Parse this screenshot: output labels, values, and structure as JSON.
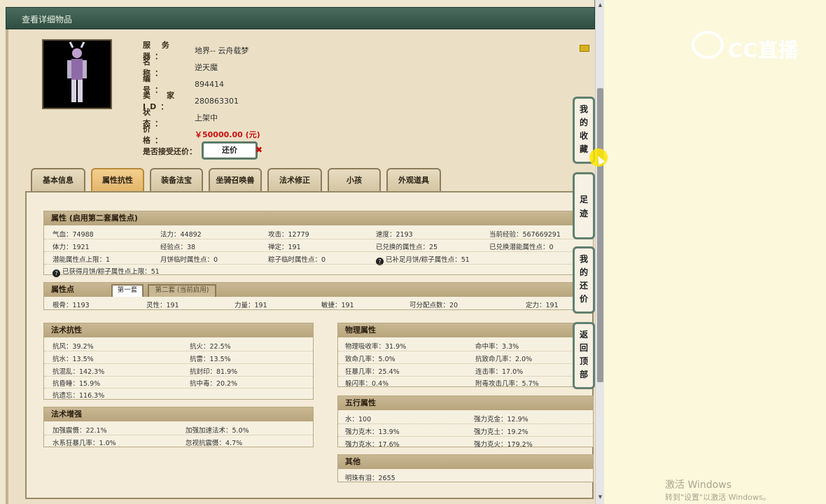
{
  "window": {
    "title": "查看详细物品"
  },
  "item": {
    "labels": {
      "server": "服 务 器：",
      "name": "名　　称：",
      "number": "编　　号：",
      "seller": "卖　家　ID：",
      "status": "状　　态：",
      "price": "价　　格：",
      "counter": "是否接受还价："
    },
    "server": "地界-- 云舟载梦",
    "name": "逆天魔",
    "number": "894414",
    "seller_id": "280863301",
    "status": "上架中",
    "price": "￥50000.00 (元)",
    "counter_button": "还价"
  },
  "tabs": [
    "基本信息",
    "属性抗性",
    "装备法宝",
    "坐骑召唤兽",
    "法术修正",
    "小孩",
    "外观道具"
  ],
  "active_tab": 1,
  "attributes": {
    "header": "属性 (启用第二套属性点)",
    "row1": [
      "气血：74988",
      "法力：44892",
      "攻击：12779",
      "速度：2193",
      "当前经验：567669291"
    ],
    "row2": [
      "体力：1921",
      "经验点：38",
      "禅定：191",
      "已兑换的属性点：25",
      "已兑换潜能属性点：0"
    ],
    "row3": [
      "潜能属性点上限：1",
      "月饼临时属性点：0",
      "粽子临时属性点：0",
      "已补足月饼/粽子属性点：51"
    ],
    "row4": "已获得月饼/粽子属性点上限：51"
  },
  "points": {
    "header": "属性点",
    "tab_first": "第一套",
    "tab_second": "第二套 (当前启用)",
    "values": [
      "根骨：1193",
      "灵性：191",
      "力量：191",
      "敏捷：191",
      "可分配点数：20",
      "定力：191"
    ]
  },
  "spell_resist": {
    "header": "法术抗性",
    "items": [
      "抗风：39.2%",
      "抗火：22.5%",
      "抗水：13.5%",
      "抗雷：13.5%",
      "抗混乱：142.3%",
      "抗封印：81.9%",
      "抗昏睡：15.9%",
      "抗中毒：20.2%",
      "抗遗忘：116.3%"
    ]
  },
  "spell_boost": {
    "header": "法术增强",
    "items": [
      "加强震慑：22.1%",
      "加强加速法术：5.0%",
      "水系狂暴几率：1.0%",
      "忽视抗震慑：4.7%"
    ]
  },
  "physical": {
    "header": "物理属性",
    "items": [
      "物理吸收率：31.9%",
      "命中率：3.3%",
      "致命几率：5.0%",
      "抗致命几率：2.0%",
      "狂暴几率：25.4%",
      "连击率：17.0%",
      "躲闪率：0.4%",
      "附毒攻击几率：5.7%"
    ]
  },
  "five_elements": {
    "header": "五行属性",
    "items": [
      "水：100",
      "强力克金：12.9%",
      "强力克木：13.9%",
      "强力克土：19.2%",
      "强力克水：17.6%",
      "强力克火：179.2%"
    ]
  },
  "other": {
    "header": "其他",
    "items": [
      "明珠有泪：2655"
    ]
  },
  "side_buttons": [
    "我的收藏",
    "足迹",
    "我的还价",
    "返回顶部"
  ],
  "logo_text": "CC直播",
  "watermark": {
    "line1": "激活 Windows",
    "line2": "转到\"设置\"以激活 Windows。"
  },
  "icons": {
    "avatar": "character-portrait",
    "fav": "favorite-icon",
    "help": "question-icon"
  }
}
